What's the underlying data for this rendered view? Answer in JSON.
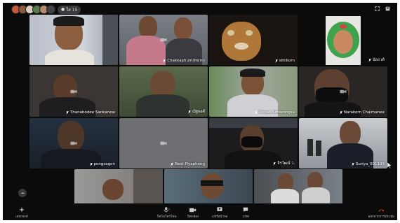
{
  "header": {
    "participant_count": "ใส 15",
    "avatars": [
      "#c45a3a",
      "#8d5a3c",
      "#d9cfc5",
      "#5a7a4a",
      "#b48a6a",
      "#444"
    ]
  },
  "tiles": [
    {
      "name": "",
      "muted": false
    },
    {
      "name": "Chakkaphum(Palm)",
      "muted": true
    },
    {
      "name": "sittikorn",
      "muted": true
    },
    {
      "name": "น้อง เต้",
      "muted": true
    },
    {
      "name": "Thanabodee Sankanew",
      "muted": true
    },
    {
      "name": "ณัฐพงศ์",
      "muted": true
    },
    {
      "name": "Petpat Sittiwongsa",
      "muted": true
    },
    {
      "name": "Narakorn Chaimanee",
      "muted": true
    },
    {
      "name": "pongsagon",
      "muted": true
    },
    {
      "name": "Best Piyaphong",
      "muted": true
    },
    {
      "name": "จิรวัฒน์ ว.",
      "muted": true
    },
    {
      "name": "Suriya_001199",
      "muted": true
    },
    {
      "name": "",
      "muted": false
    },
    {
      "name": "",
      "muted": false
    },
    {
      "name": "",
      "muted": false
    }
  ],
  "controls": {
    "effects": "เอฟเฟกต์",
    "mic": "ปิดไมโครโฟน",
    "camera": "ปิดกล้อง",
    "share": "แชร์หน้าจอ",
    "chat": "แชท",
    "leave": "ออกจากการประชุม"
  },
  "colors": {
    "background": "#0b0b0c",
    "tile_placeholder": "#2b2d30",
    "leave": "#e3423a"
  }
}
